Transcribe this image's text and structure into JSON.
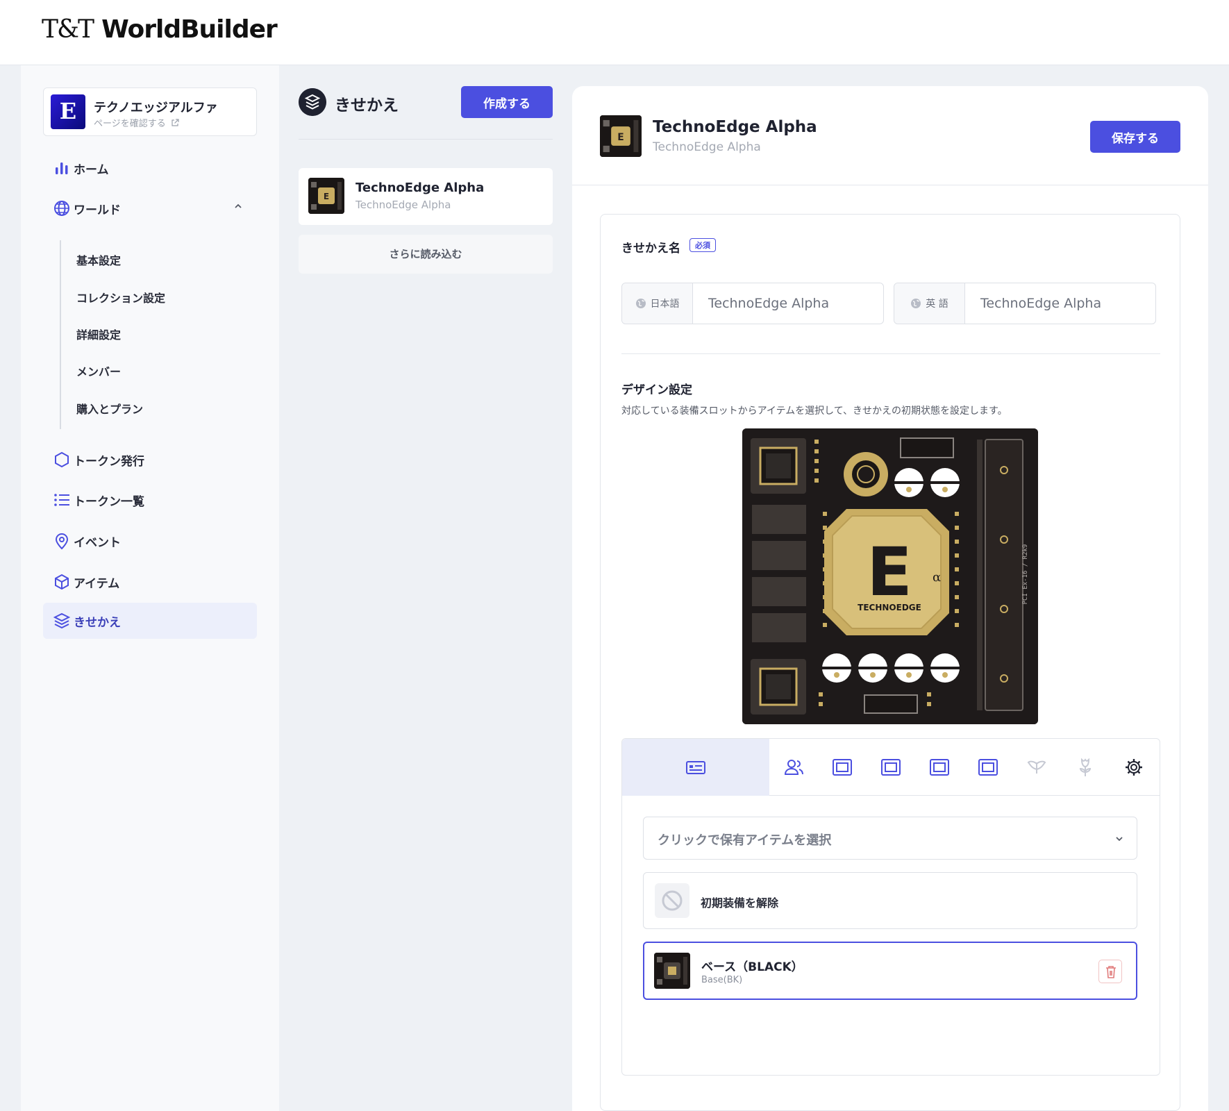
{
  "app": {
    "logo_prefix": "T&T",
    "logo_name": "WorldBuilder"
  },
  "org": {
    "name": "テクノエッジアルファ",
    "link": "ページを確認する",
    "logo_letter": "E"
  },
  "nav": {
    "home": "ホーム",
    "world": "ワールド",
    "world_sub": [
      "基本設定",
      "コレクション設定",
      "詳細設定",
      "メンバー",
      "購入とプラン"
    ],
    "token_issue": "トークン発行",
    "token_list": "トークン一覧",
    "event": "イベント",
    "item": "アイテム",
    "kisekae": "きせかえ"
  },
  "middle": {
    "title": "きせかえ",
    "create_button": "作成する",
    "items": [
      {
        "title": "TechnoEdge Alpha",
        "subtitle": "TechnoEdge Alpha"
      }
    ],
    "load_more": "さらに読み込む"
  },
  "main": {
    "title": "TechnoEdge Alpha",
    "subtitle": "TechnoEdge Alpha",
    "save_button": "保存する",
    "name_section": "きせかえ名",
    "required": "必須",
    "lang_ja_label": "日本語",
    "lang_ja_value": "TechnoEdge Alpha",
    "lang_en_label": "英 語",
    "lang_en_value": "TechnoEdge Alpha",
    "design_section": "デザイン設定",
    "design_desc": "対応している装備スロットからアイテムを選択して、きせかえの初期状態を設定します。",
    "select_placeholder": "クリックで保有アイテムを選択",
    "unequip_label": "初期装備を解除",
    "equipped_name": "ベース（BLACK）",
    "equipped_sub": "Base(BK)"
  },
  "board": {
    "brand": "TECHNOEDGE",
    "letter": "E",
    "alpha": "α",
    "side_text": "PCI Ex-16 / R2k9"
  },
  "colors": {
    "accent": "#4b4fe0",
    "gold": "#c9ad62",
    "board": "#1e1a1a"
  }
}
